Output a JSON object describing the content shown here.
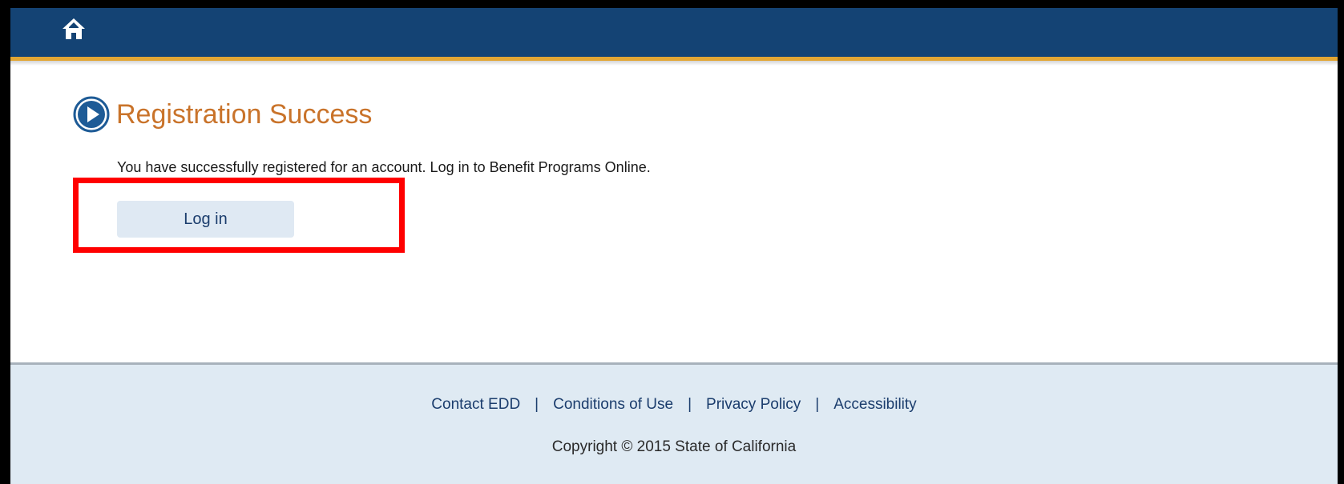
{
  "header": {
    "home_icon": "home-icon",
    "background": "#144374",
    "accent": "#e2a634"
  },
  "main": {
    "title_icon": "play-circle-icon",
    "title": "Registration Success",
    "message": "You have successfully registered for an account. Log in to Benefit Programs Online.",
    "login_button_label": "Log in"
  },
  "footer": {
    "links": [
      "Contact EDD",
      "Conditions of Use",
      "Privacy Policy",
      "Accessibility"
    ],
    "separator": "|",
    "copyright": "Copyright © 2015 State of California"
  },
  "colors": {
    "title": "#c9732a",
    "highlight": "#ff0000",
    "footer_background": "#dfeaf3",
    "link": "#1b3d6d"
  }
}
